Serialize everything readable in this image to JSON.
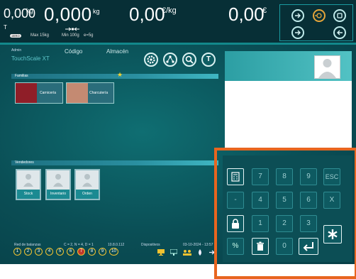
{
  "header": {
    "weight_small": "0,000",
    "weight_small_unit": "kg",
    "tare_flag": "T",
    "weight_main": "0,000",
    "weight_main_unit": "kg",
    "zero_indicator": "ZERO",
    "max_label": "Max 15kg",
    "min_label": "Min 100g",
    "e_label": "e=5g",
    "price_value": "0,00",
    "price_unit": "€/kg",
    "total_value": "0,00",
    "total_unit": "€",
    "buttons": [
      "login-icon",
      "record-icon",
      "power-icon",
      "logout-icon",
      "reload-icon"
    ]
  },
  "toolbar": {
    "admin": "Admin",
    "brand": "TouchScale XT",
    "codigo": "Código",
    "almacen": "Almacén",
    "tools": [
      "settings-icon",
      "share-icon",
      "search-icon",
      "tare-icon"
    ],
    "tare_letter": "T"
  },
  "families": {
    "label": "Familias",
    "items": [
      {
        "name": "Carnicería",
        "color": "#8f1e28"
      },
      {
        "name": "Charcutería",
        "color": "#c48a72"
      }
    ]
  },
  "vendors": {
    "label": "Vendedores",
    "items": [
      "Stock",
      "Inventario",
      "Orden"
    ]
  },
  "keypad": {
    "rows": [
      [
        "calc-icon",
        "7",
        "8",
        "9",
        "ESC"
      ],
      [
        "-",
        "4",
        "5",
        "6",
        "X"
      ],
      [
        "lock-icon",
        "1",
        "2",
        "3",
        "asterisk-icon"
      ],
      [
        "%",
        "trash-icon",
        "0",
        "enter-icon"
      ]
    ]
  },
  "footer": {
    "red_label": "Red de balanzas",
    "cn_label": "C = 2, N = 4, D = 1",
    "ip_label": "10.8.0.112",
    "disp_label": "Dispositivos",
    "date_label": "03-10-2024 - 13:57",
    "scales": [
      "1",
      "2",
      "3",
      "4",
      "5",
      "6",
      "7",
      "8",
      "9",
      "10"
    ]
  },
  "colors": {
    "accent": "#12888b",
    "highlight": "#e8651f",
    "scale_ring": "#f1c230",
    "scale_active": "#c0392b"
  }
}
